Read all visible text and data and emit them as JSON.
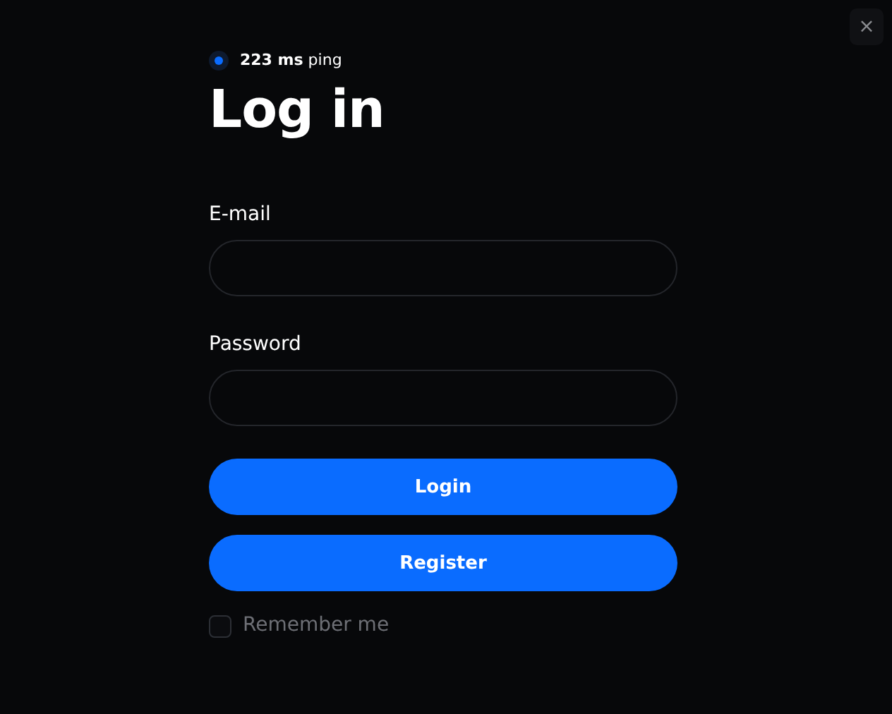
{
  "close_button": {
    "label": "×"
  },
  "status": {
    "text": "**223 ms** ping",
    "color": "#0a6cff"
  },
  "title": "Log in",
  "fields": [
    {
      "label": "E-mail"
    },
    {
      "label": "Password"
    }
  ],
  "buttons": [
    "Login",
    "Register"
  ],
  "remember": {
    "label": "Remember me",
    "checked": false
  }
}
